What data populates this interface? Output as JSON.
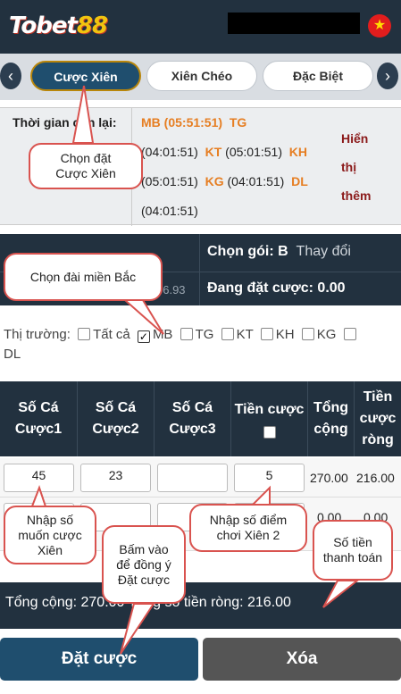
{
  "header": {
    "logo_main": "Tobet",
    "logo_num": "88",
    "flag_icon": "vietnam-flag-icon"
  },
  "tabs": [
    {
      "label": "Cược Xiên",
      "active": true
    },
    {
      "label": "Xiên Chéo",
      "active": false
    },
    {
      "label": "Đặc Biệt",
      "active": false
    }
  ],
  "countdown": {
    "label": "Thời gian còn lại:",
    "items": [
      {
        "code": "MB",
        "time": "(05:51:51)"
      },
      {
        "code": "TG",
        "time": "(04:01:51)"
      },
      {
        "code": "KT",
        "time": "(05:01:51)"
      },
      {
        "code": "KH",
        "time": "(05:01:51)"
      },
      {
        "code": "KG",
        "time": "(04:01:51)"
      },
      {
        "code": "DL",
        "time": "(04:01:51)"
      }
    ],
    "more_line1": "Hiển",
    "more_line2": "thị",
    "more_line3": "thêm"
  },
  "info": {
    "package_label": "Chọn gói:",
    "package_value": "B",
    "change_label": "Thay đổi",
    "betting_label": "Đang đặt cược: 0.00",
    "balance_partial": "06.93"
  },
  "market": {
    "label": "Thị trường:",
    "options": [
      {
        "label": "Tất cả",
        "checked": false
      },
      {
        "label": "MB",
        "checked": true
      },
      {
        "label": "TG",
        "checked": false
      },
      {
        "label": "KT",
        "checked": false
      },
      {
        "label": "KH",
        "checked": false
      },
      {
        "label": "KG",
        "checked": false
      },
      {
        "label": "DL",
        "checked": false
      }
    ]
  },
  "table": {
    "headers": {
      "col1a": "Số Cá",
      "col1b": "Cược1",
      "col2a": "Số Cá",
      "col2b": "Cược2",
      "col3a": "Số Cá",
      "col3b": "Cược3",
      "col4": "Tiền cược",
      "col5a": "Tổng",
      "col5b": "cộng",
      "col6a": "Tiền",
      "col6b": "cược",
      "col6c": "ròng"
    },
    "row1": {
      "num1": "45",
      "num2": "23",
      "num3": "",
      "amount": "5",
      "total": "270.00",
      "net": "216.00"
    },
    "row2": {
      "total": "0.00",
      "net": "0.00"
    }
  },
  "totals": {
    "text": "Tổng cộng: 270.00  Tổng số tiền ròng: 216.00"
  },
  "buttons": {
    "bet": "Đặt cược",
    "clear": "Xóa"
  },
  "callouts": {
    "c1_line1": "Chọn đặt",
    "c1_line2": "Cược Xiên",
    "c2": "Chọn đài miền Bắc",
    "c3_line1": "Nhập số",
    "c3_line2": "muốn cược",
    "c3_line3": "Xiên",
    "c4_line1": "Bấm vào",
    "c4_line2": "để đồng ý",
    "c4_line3": "Đặt cược",
    "c5_line1": "Nhập số điểm",
    "c5_line2": "chơi Xiên 2",
    "c6_line1": "Số tiền",
    "c6_line2": "thanh toán"
  },
  "colors": {
    "navy": "#22313f",
    "accent_red": "#d9534f",
    "orange": "#e67e22"
  }
}
